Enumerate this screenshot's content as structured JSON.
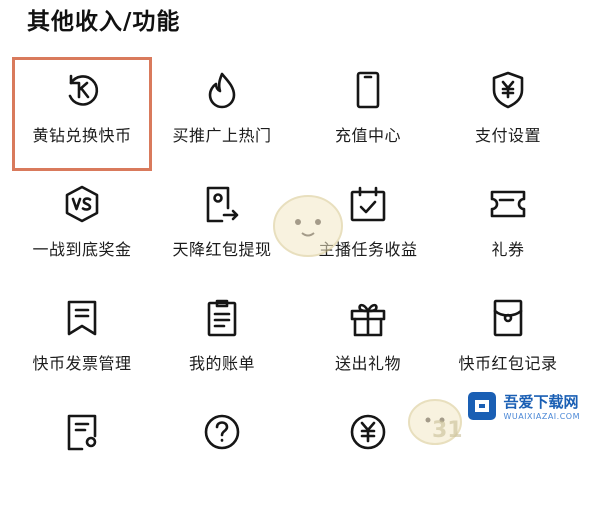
{
  "section": {
    "title": "其他收入/功能"
  },
  "grid": {
    "rows": [
      [
        {
          "label": "黄钻兑换快币",
          "icon": "k-coin-exchange-icon"
        },
        {
          "label": "买推广上热门",
          "icon": "flame-icon"
        },
        {
          "label": "充值中心",
          "icon": "phone-icon"
        },
        {
          "label": "支付设置",
          "icon": "yen-shield-icon"
        }
      ],
      [
        {
          "label": "一战到底奖金",
          "icon": "vs-badge-icon"
        },
        {
          "label": "天降红包提现",
          "icon": "withdraw-icon"
        },
        {
          "label": "主播任务收益",
          "icon": "calendar-check-icon"
        },
        {
          "label": "礼券",
          "icon": "ticket-icon"
        }
      ],
      [
        {
          "label": "快币发票管理",
          "icon": "bookmark-doc-icon"
        },
        {
          "label": "我的账单",
          "icon": "clipboard-icon"
        },
        {
          "label": "送出礼物",
          "icon": "gift-icon"
        },
        {
          "label": "快币红包记录",
          "icon": "red-packet-icon"
        }
      ],
      [
        {
          "label": "",
          "icon": "document-user-icon"
        },
        {
          "label": "",
          "icon": "help-icon"
        },
        {
          "label": "",
          "icon": "yen-circle-icon"
        }
      ]
    ]
  },
  "watermark": {
    "title": "吾爱下载网",
    "url": "WUAIXIAZAI.COM",
    "corner_text": "31"
  },
  "colors": {
    "highlight": "#d97a5c",
    "icon_stroke": "#161616",
    "watermark_blue": "#1a5fb4"
  }
}
